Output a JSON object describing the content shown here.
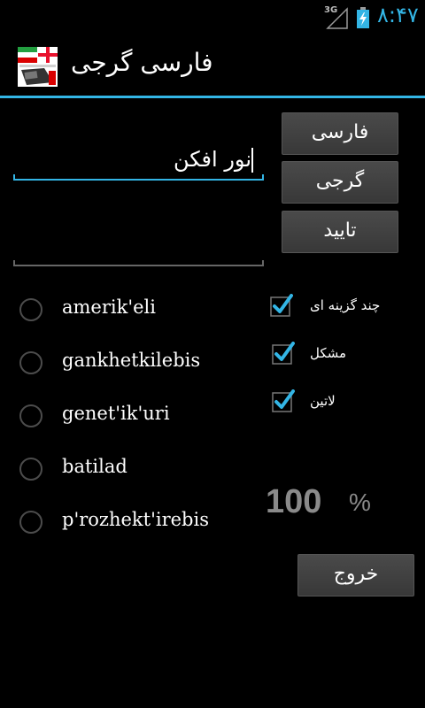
{
  "status_bar": {
    "network_type": "3G",
    "time": "۸:۴۷"
  },
  "app": {
    "title": "فارسی گرجی"
  },
  "input": {
    "value": "نور افکن"
  },
  "output": {
    "value": ""
  },
  "buttons": {
    "persian": "فارسی",
    "georgian": "گرجی",
    "confirm": "تایید",
    "exit": "خروج"
  },
  "options": [
    {
      "label": "amerik'eli",
      "selected": false
    },
    {
      "label": "gankhetkilebis",
      "selected": false
    },
    {
      "label": "genet'ik'uri",
      "selected": false
    },
    {
      "label": "batilad",
      "selected": false
    },
    {
      "label": "p'rozhekt'irebis",
      "selected": false
    }
  ],
  "settings": {
    "multiple_choice": {
      "label": "چند گزینه ای",
      "checked": true
    },
    "difficult": {
      "label": "مشکل",
      "checked": true
    },
    "latin": {
      "label": "لاتین",
      "checked": true
    }
  },
  "score": {
    "value": "100",
    "unit": "%"
  },
  "colors": {
    "accent": "#33b5e5",
    "background": "#000000",
    "button": "#404040",
    "score_text": "#8a8a8a"
  }
}
